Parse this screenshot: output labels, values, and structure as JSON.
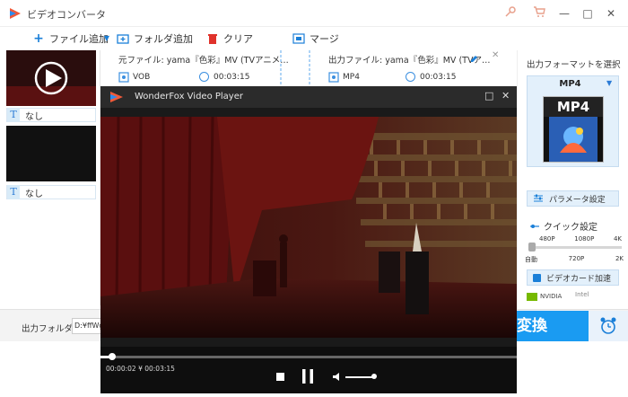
{
  "window": {
    "title": "ビデオコンバータ",
    "minimize": "—",
    "maximize": "□",
    "close": "✕",
    "icons": [
      "key-icon",
      "cart-icon"
    ]
  },
  "toolbar": {
    "add_file_label": "ファイル追加",
    "add_folder_label": "フォルダ追加",
    "clear_label": "クリア",
    "merge_label": "マージ"
  },
  "items": [
    {
      "subtitle": "なし"
    },
    {
      "subtitle": "なし"
    }
  ],
  "file_info": {
    "source_label": "元ファイル: yama『色彩』MV (TVアニメ…",
    "source_format": "VOB",
    "source_duration": "00:03:15",
    "output_label": "出力ファイル: yama『色彩』MV (TVア…",
    "output_format": "MP4",
    "output_duration": "00:03:15",
    "close": "✕"
  },
  "right_panel": {
    "title": "出力フォーマットを選択",
    "format": "MP4",
    "format_icon_text": "MP4",
    "param_button": "パラメータ設定",
    "quick_title": "クイック設定",
    "slider_top": [
      "480P",
      "1080P",
      "4K"
    ],
    "slider_bottom": [
      "自動",
      "720P",
      "2K"
    ],
    "quick_level": 0,
    "gpu_button": "ビデオカード加速",
    "nvidia": "NVIDIA",
    "intel": "Intel"
  },
  "bottom": {
    "output_folder_label": "出力フォルダ：",
    "output_folder_value": "D:¥ffWg",
    "convert_label": "変換"
  },
  "player": {
    "title": "WonderFox Video Player",
    "time": "00:00:02 ¥ 00:03:15",
    "progress": 0.01,
    "volume": 1.0,
    "maximize": "□",
    "close": "✕"
  },
  "colors": {
    "accent": "#1a9bf2",
    "panel_highlight": "#e3f0fb",
    "player_bg": "#1a1a1a"
  }
}
